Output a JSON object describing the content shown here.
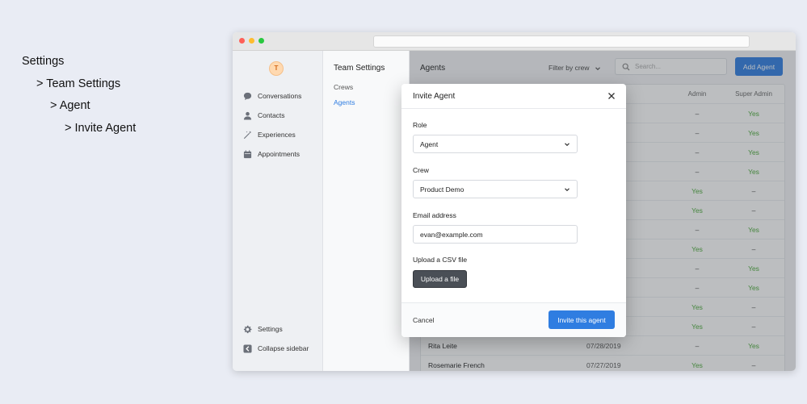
{
  "breadcrumb": [
    "Settings",
    "> Team Settings",
    "> Agent",
    "> Invite Agent"
  ],
  "sidebar": {
    "logo_text": "T",
    "items": [
      {
        "label": "Conversations",
        "icon": "chat-bubble-icon"
      },
      {
        "label": "Contacts",
        "icon": "person-icon"
      },
      {
        "label": "Experiences",
        "icon": "magic-wand-icon"
      },
      {
        "label": "Appointments",
        "icon": "calendar-icon"
      }
    ],
    "bottom": [
      {
        "label": "Settings",
        "icon": "gear-icon"
      },
      {
        "label": "Collapse sidebar",
        "icon": "collapse-icon"
      }
    ]
  },
  "subnav": {
    "title": "Team Settings",
    "links": [
      "Crews",
      "Agents"
    ],
    "active": "Agents"
  },
  "main": {
    "title": "Agents",
    "filter_label": "Filter by crew",
    "search_placeholder": "Search...",
    "add_button": "Add Agent",
    "columns": [
      "Admin",
      "Super Admin"
    ],
    "rows": [
      {
        "name": "",
        "date": "",
        "admin": "–",
        "super_admin": "Yes"
      },
      {
        "name": "",
        "date": "",
        "admin": "–",
        "super_admin": "Yes"
      },
      {
        "name": "",
        "date": "",
        "admin": "–",
        "super_admin": "Yes"
      },
      {
        "name": "",
        "date": "",
        "admin": "–",
        "super_admin": "Yes"
      },
      {
        "name": "",
        "date": "",
        "admin": "Yes",
        "super_admin": "–"
      },
      {
        "name": "",
        "date": "",
        "admin": "Yes",
        "super_admin": "–"
      },
      {
        "name": "",
        "date": "",
        "admin": "–",
        "super_admin": "Yes"
      },
      {
        "name": "",
        "date": "",
        "admin": "Yes",
        "super_admin": "–"
      },
      {
        "name": "",
        "date": "",
        "admin": "–",
        "super_admin": "Yes"
      },
      {
        "name": "",
        "date": "",
        "admin": "–",
        "super_admin": "Yes"
      },
      {
        "name": "",
        "date": "",
        "admin": "Yes",
        "super_admin": "–"
      },
      {
        "name": "",
        "date": "",
        "admin": "Yes",
        "super_admin": "–"
      },
      {
        "name": "Rita Leite",
        "date": "07/28/2019",
        "admin": "–",
        "super_admin": "Yes"
      },
      {
        "name": "Rosemarie French",
        "date": "07/27/2019",
        "admin": "Yes",
        "super_admin": "–"
      }
    ]
  },
  "modal": {
    "title": "Invite Agent",
    "role_label": "Role",
    "role_value": "Agent",
    "crew_label": "Crew",
    "crew_value": "Product Demo",
    "email_label": "Email address",
    "email_value": "evan@example.com",
    "csv_label": "Upload a CSV file",
    "upload_button": "Upload a file",
    "cancel": "Cancel",
    "submit": "Invite this agent"
  },
  "colors": {
    "accent": "#2f7de1",
    "yes": "#4caa3a",
    "background": "#e9ecf4"
  }
}
